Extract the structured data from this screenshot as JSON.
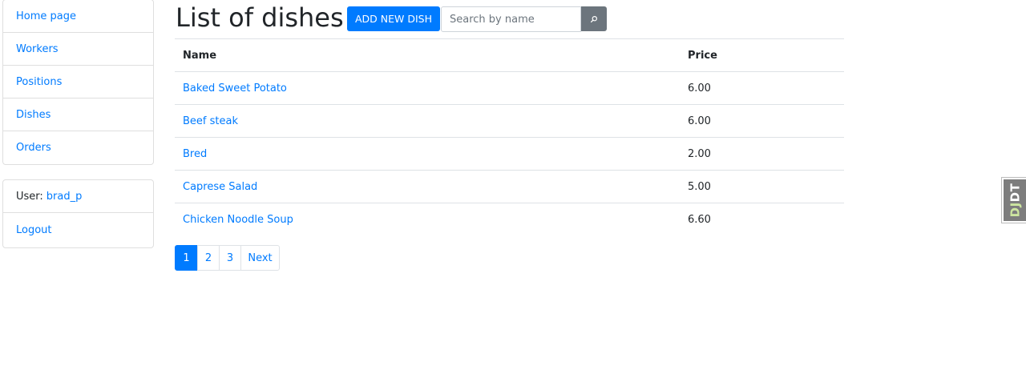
{
  "sidebar": {
    "items": [
      {
        "label": "Home page"
      },
      {
        "label": "Workers"
      },
      {
        "label": "Positions"
      },
      {
        "label": "Dishes"
      },
      {
        "label": "Orders"
      }
    ],
    "user_label": "User:",
    "username": "brad_p",
    "logout_label": "Logout"
  },
  "header": {
    "title": "List of dishes",
    "add_button_label": "ADD NEW DISH",
    "search_placeholder": "Search by name",
    "search_value": ""
  },
  "table": {
    "columns": [
      "Name",
      "Price"
    ],
    "rows": [
      {
        "name": "Baked Sweet Potato",
        "price": "6.00"
      },
      {
        "name": "Beef steak",
        "price": "6.00"
      },
      {
        "name": "Bred",
        "price": "2.00"
      },
      {
        "name": "Caprese Salad",
        "price": "5.00"
      },
      {
        "name": "Chicken Noodle Soup",
        "price": "6.60"
      }
    ]
  },
  "pagination": {
    "pages": [
      "1",
      "2",
      "3"
    ],
    "current_page": "1",
    "next_label": "Next"
  },
  "debug_toolbar": {
    "prefix": "DJ",
    "suffix": "DT"
  },
  "colors": {
    "primary": "#007bff",
    "secondary": "#6c757d",
    "text": "#212529",
    "border": "#dee2e6"
  },
  "icons": {
    "search": "search-icon"
  }
}
